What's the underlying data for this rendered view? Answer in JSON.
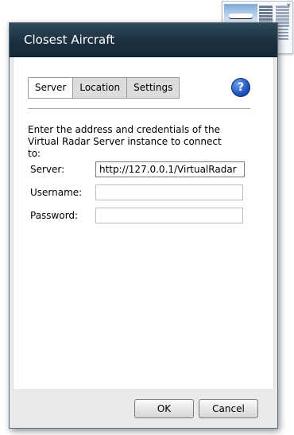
{
  "dialog": {
    "title": "Closest Aircraft"
  },
  "tabs": [
    {
      "label": "Server",
      "active": true
    },
    {
      "label": "Location",
      "active": false
    },
    {
      "label": "Settings",
      "active": false
    }
  ],
  "help": {
    "glyph": "?"
  },
  "intro_text": "Enter the address and credentials of the Virtual Radar Server instance to connect to:",
  "form": {
    "server_label": "Server:",
    "server_value": "http://127.0.0.1/VirtualRadar",
    "username_label": "Username:",
    "username_value": "",
    "password_label": "Password:",
    "password_value": ""
  },
  "buttons": {
    "ok_label": "OK",
    "cancel_label": "Cancel"
  },
  "gadget": {
    "close_glyph": "✕"
  }
}
